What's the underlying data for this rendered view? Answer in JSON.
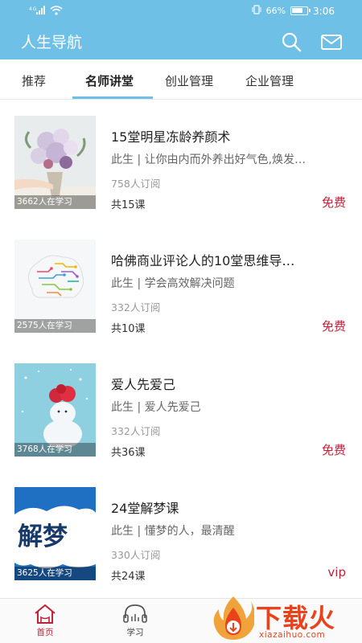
{
  "status_bar": {
    "battery": "66%",
    "time": "3:06",
    "signal": "46"
  },
  "app_bar": {
    "title": "人生导航",
    "icons": [
      "search-icon",
      "mail-icon"
    ]
  },
  "tabs": [
    {
      "label": "推荐",
      "active": false
    },
    {
      "label": "名师讲堂",
      "active": true
    },
    {
      "label": "创业管理",
      "active": false
    },
    {
      "label": "企业管理",
      "active": false
    }
  ],
  "courses": [
    {
      "title": "15堂明星冻龄养颜术",
      "desc": "此生 | 让你由内而外养出好气色,焕发…",
      "subs": "758人订阅",
      "count": "共15课",
      "price": "免费",
      "learners": "3662人在学习"
    },
    {
      "title": "哈佛商业评论人的10堂思维导…",
      "desc": "此生 | 学会高效解决问题",
      "subs": "332人订阅",
      "count": "共10课",
      "price": "免费",
      "learners": "2575人在学习"
    },
    {
      "title": "爱人先爱己",
      "desc": "此生 | 爱人先爱己",
      "subs": "332人订阅",
      "count": "共36课",
      "price": "免费",
      "learners": "3768人在学习"
    },
    {
      "title": "24堂解梦课",
      "desc": "此生 | 懂梦的人，最清醒",
      "subs": "330人订阅",
      "count": "共24课",
      "price": "vip",
      "learners": "3625人在学习",
      "cover_text": "解梦"
    }
  ],
  "bottom_nav": [
    {
      "label": "首页",
      "active": true
    },
    {
      "label": "学习",
      "active": false
    }
  ],
  "watermark": {
    "text": "下载火",
    "url": "xiazaihuo.com"
  },
  "colors": {
    "primary": "#6ec0e6",
    "price_red": "#c0223a",
    "watermark": "#e8431c"
  }
}
